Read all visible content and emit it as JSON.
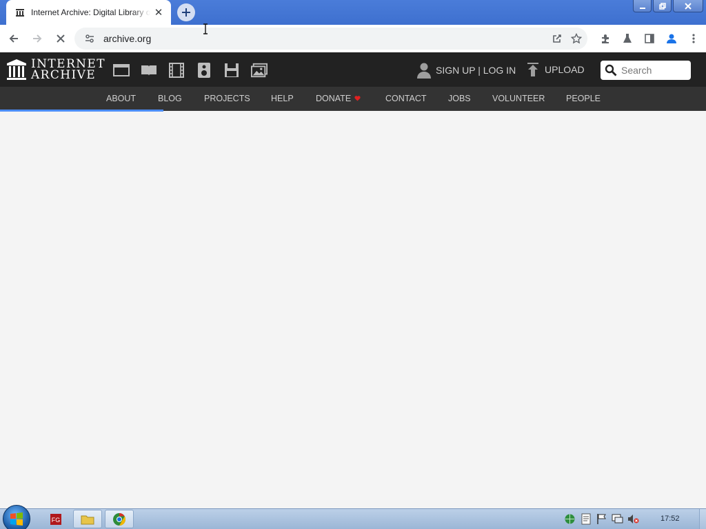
{
  "browser": {
    "tab_title": "Internet Archive: Digital Library of Free & Borrowable Books, Movies, Music & Wayback Machine",
    "url": "archive.org"
  },
  "site": {
    "logo_line1": "INTERNET",
    "logo_line2": "ARCHIVE",
    "media_icons": [
      "web-icon",
      "texts-icon",
      "video-icon",
      "audio-icon",
      "software-icon",
      "images-icon"
    ],
    "user_link": "SIGN UP | LOG IN",
    "upload_label": "UPLOAD",
    "search_placeholder": "Search",
    "nav": [
      "ABOUT",
      "BLOG",
      "PROJECTS",
      "HELP",
      "DONATE",
      "CONTACT",
      "JOBS",
      "VOLUNTEER",
      "PEOPLE"
    ]
  },
  "taskbar": {
    "clock": "17:52"
  },
  "colors": {
    "header_bg": "#222222",
    "nav_bg": "#333333",
    "donate_heart": "#e02020",
    "progress": "#4b8df8"
  }
}
